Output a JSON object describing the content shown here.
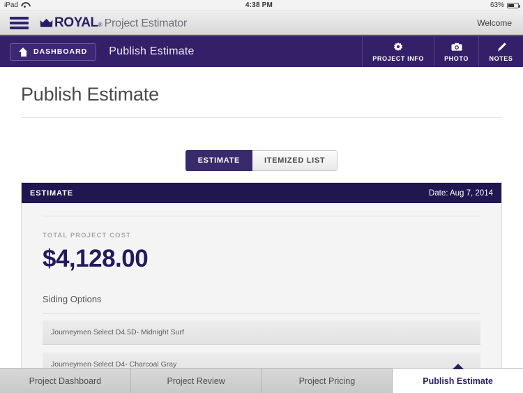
{
  "statusbar": {
    "device": "iPad",
    "wifi_icon": "wifi-icon",
    "time": "4:38 PM",
    "battery_percent": "63%",
    "battery_icon": "battery-icon"
  },
  "brandbar": {
    "menu_icon": "hamburger-menu-icon",
    "crown_icon": "crown-icon",
    "logo_name": "ROYAL",
    "logo_mark": "®",
    "logo_subtitle": "Project Estimator",
    "welcome_label": "Welcome"
  },
  "navbar": {
    "dashboard_label": "DASHBOARD",
    "dashboard_icon": "home-icon",
    "page_title": "Publish Estimate",
    "tools": [
      {
        "label": "PROJECT INFO",
        "icon": "gear-icon"
      },
      {
        "label": "PHOTO",
        "icon": "camera-icon"
      },
      {
        "label": "NOTES",
        "icon": "pencil-icon"
      }
    ]
  },
  "main": {
    "page_heading": "Publish Estimate",
    "view_toggle": [
      {
        "label": "ESTIMATE",
        "active": true
      },
      {
        "label": "ITEMIZED LIST",
        "active": false
      }
    ],
    "card": {
      "header_title": "ESTIMATE",
      "header_date": "Date: Aug 7, 2014",
      "cost_label": "TOTAL PROJECT COST",
      "cost_value": "$4,128.00",
      "section_title": "Siding Options",
      "options": [
        "Journeymen Select D4.5D- Midnight Surf",
        "Journeymen Select D4- Charcoal Gray"
      ]
    }
  },
  "tabbar": {
    "tabs": [
      {
        "label": "Project Dashboard",
        "active": false
      },
      {
        "label": "Project Review",
        "active": false
      },
      {
        "label": "Project Pricing",
        "active": false
      },
      {
        "label": "Publish Estimate",
        "active": true
      }
    ]
  },
  "colors": {
    "nav_purple": "#342068",
    "card_navy": "#1e1750",
    "accent_text": "#2b1c62",
    "body_gray": "#f4f4f4"
  }
}
